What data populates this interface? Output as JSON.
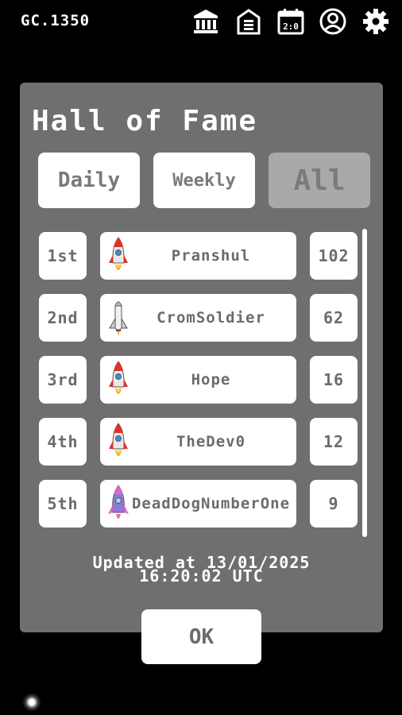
{
  "header": {
    "coins": "GC.1350",
    "icons": [
      "bank-icon",
      "building-icon",
      "calendar-icon",
      "profile-icon",
      "settings-icon"
    ]
  },
  "hall": {
    "title": "Hall of Fame",
    "tabs": [
      {
        "label": "Daily",
        "active": false
      },
      {
        "label": "Weekly",
        "active": false
      },
      {
        "label": "All",
        "active": true
      }
    ],
    "entries": [
      {
        "rank": "1st",
        "name": "Pranshul",
        "score": "102",
        "ship": "red-rocket"
      },
      {
        "rank": "2nd",
        "name": "CromSoldier",
        "score": "62",
        "ship": "shuttle"
      },
      {
        "rank": "3rd",
        "name": "Hope",
        "score": "16",
        "ship": "red-rocket"
      },
      {
        "rank": "4th",
        "name": "TheDev0",
        "score": "12",
        "ship": "red-rocket"
      },
      {
        "rank": "5th",
        "name": "DeadDogNumberOne",
        "score": "9",
        "ship": "purple-rocket"
      }
    ],
    "updated_line1": "Updated at 13/01/2025",
    "updated_line2": "16:20:02 UTC",
    "ok_label": "OK"
  },
  "colors": {
    "panel": "#6f6f6f",
    "background": "#000000",
    "active_tab": "#a9a9a9",
    "text_gray": "#6b6b6b"
  }
}
